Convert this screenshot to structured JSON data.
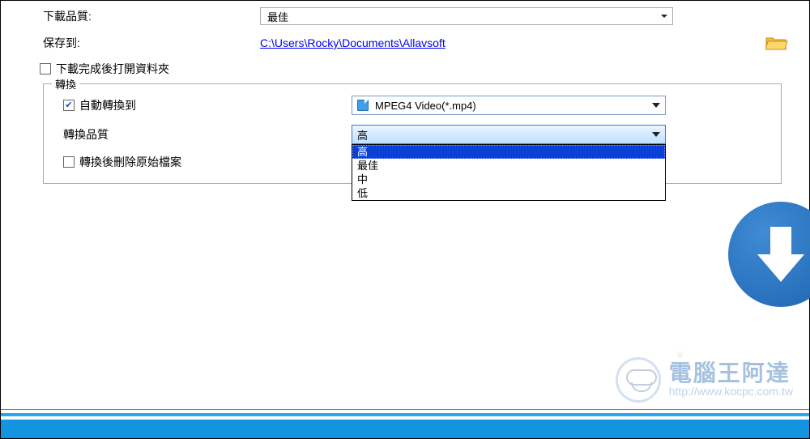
{
  "download_quality": {
    "label": "下載品質:",
    "value": "最佳"
  },
  "save_to": {
    "label": "保存到:",
    "path": "C:\\Users\\Rocky\\Documents\\Allavsoft"
  },
  "open_folder_after_download": {
    "label": "下載完成後打開資料夾",
    "checked": false
  },
  "convert_group": {
    "title": "轉換",
    "auto_convert": {
      "label": "自動轉換到",
      "checked": true,
      "format": "MPEG4 Video(*.mp4)"
    },
    "convert_quality": {
      "label": "轉換品質",
      "selected": "高",
      "options": [
        "高",
        "最佳",
        "中",
        "低"
      ],
      "open": true
    },
    "delete_original_after_convert": {
      "label": "轉換後刪除原始檔案",
      "checked": false
    }
  },
  "watermark": {
    "title": "電腦王阿達",
    "url": "http://www.kocpc.com.tw"
  }
}
